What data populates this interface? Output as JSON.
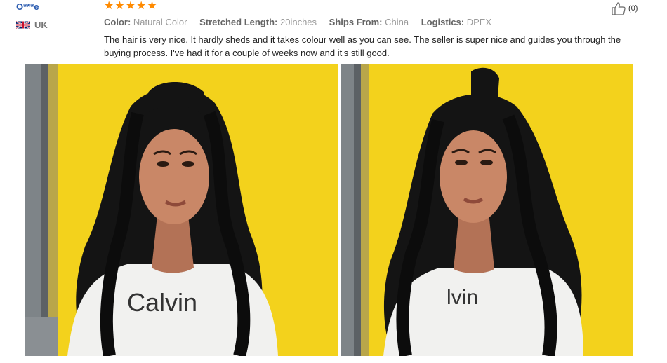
{
  "reviewer": {
    "name": "O***e",
    "country": "UK"
  },
  "rating": {
    "stars": 5,
    "max": 5,
    "color": "#ff8a00"
  },
  "attributes": [
    {
      "key": "Color:",
      "value": "Natural Color"
    },
    {
      "key": "Stretched Length:",
      "value": "20inches"
    },
    {
      "key": "Ships From:",
      "value": "China"
    },
    {
      "key": "Logistics:",
      "value": "DPEX"
    }
  ],
  "review_text": "The hair is very nice. It hardly sheds and it takes colour well as you can see. The seller is super nice and guides you through the buying process. I've had it for a couple of weeks now and it's still good.",
  "helpful": {
    "count": "(0)",
    "icon": "thumbs-up-icon"
  },
  "photos": [
    {
      "shirt_text": "Calvin"
    },
    {
      "shirt_text": "lvin"
    }
  ],
  "colors": {
    "link": "#2a5bb0",
    "wall": "#f2cf1a",
    "hair": "#141414"
  }
}
